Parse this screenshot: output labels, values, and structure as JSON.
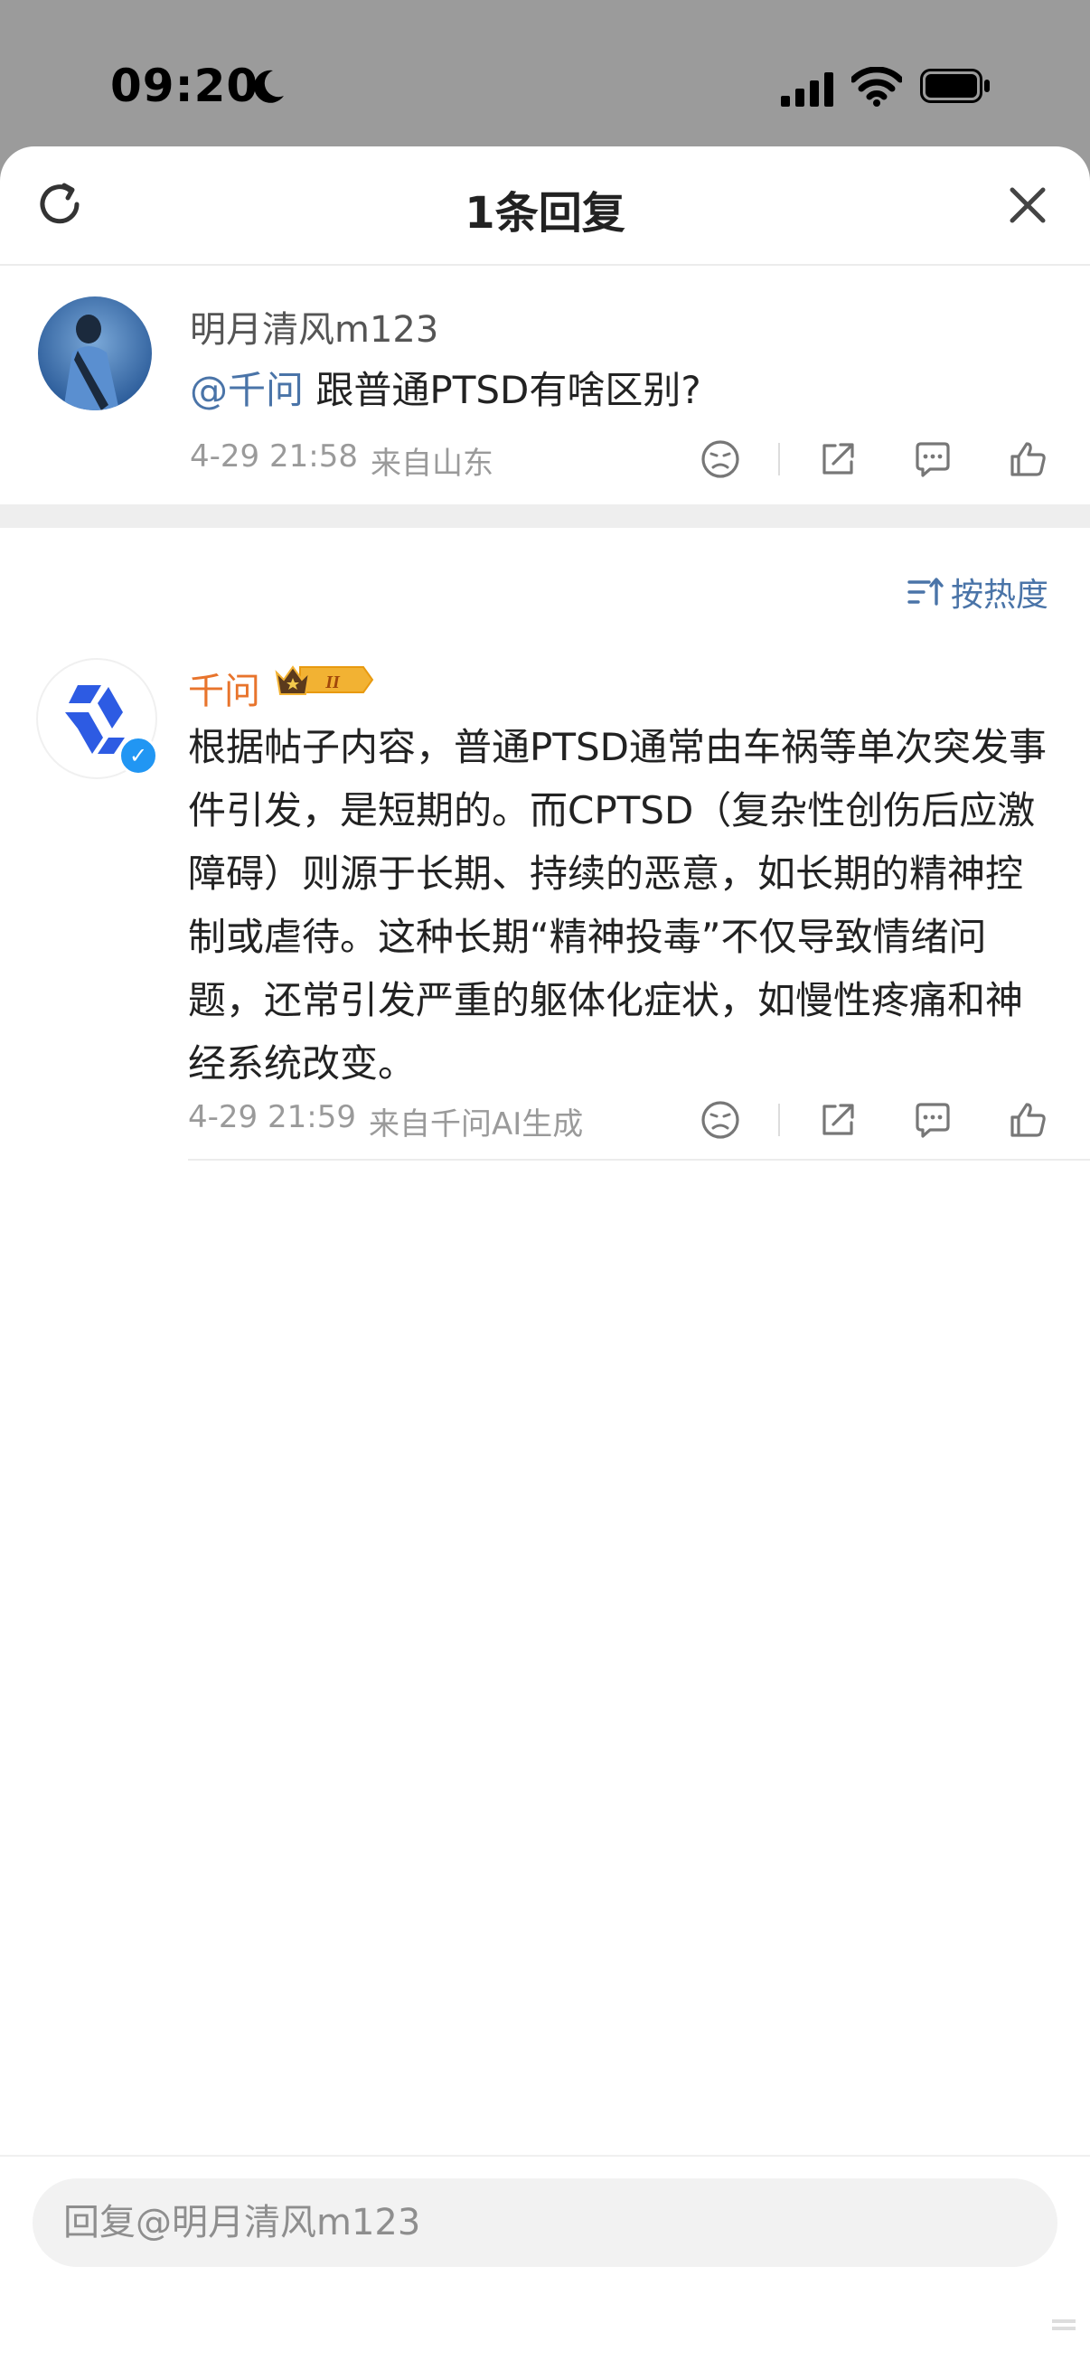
{
  "status_bar": {
    "time": "09:20"
  },
  "sheet": {
    "title": "1条回复"
  },
  "parent_comment": {
    "username": "明月清风m123",
    "mention": "@千问",
    "text": " 跟普通PTSD有啥区别?",
    "timestamp": "4-29 21:58",
    "location": "来自山东"
  },
  "sort": {
    "label": "按热度"
  },
  "reply": {
    "author": "千问",
    "level_badge": "II",
    "text": "根据帖子内容，普通PTSD通常由车祸等单次突发事件引发，是短期的。而CPTSD（复杂性创伤后应激障碍）则源于长期、持续的恶意，如长期的精神控制或虐待。这种长期“精神投毒”不仅导致情绪问题，还常引发严重的躯体化症状，如慢性疼痛和神经系统改变。",
    "timestamp": "4-29 21:59",
    "source": "来自千问AI生成"
  },
  "input": {
    "placeholder": "回复@明月清风m123"
  },
  "colors": {
    "accent_blue": "#4a74a8",
    "ai_name": "#e8742c",
    "brand_blue": "#2d5be3"
  },
  "icons": [
    "refresh-icon",
    "close-icon",
    "dislike-face-icon",
    "share-icon",
    "comment-icon",
    "like-icon",
    "sort-icon",
    "verified-icon",
    "crown-icon"
  ]
}
